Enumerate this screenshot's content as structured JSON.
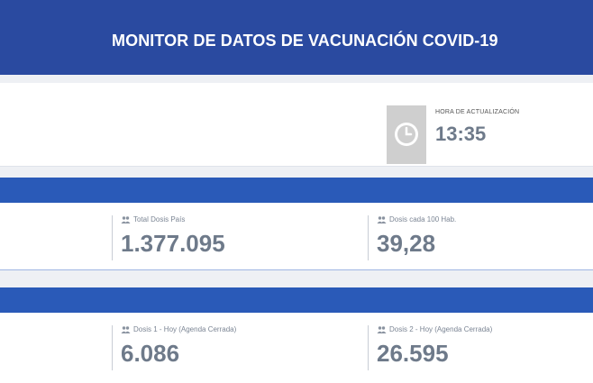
{
  "header": {
    "title": "MONITOR DE DATOS DE VACUNACIÓN COVID-19"
  },
  "update": {
    "label": "HORA DE ACTUALIZACIÓN",
    "time": "13:35",
    "icon": "clock-icon"
  },
  "stats_row1": [
    {
      "label": "Total Dosis País",
      "value": "1.377.095",
      "icon": "users-icon"
    },
    {
      "label": "Dosis cada 100 Hab.",
      "value": "39,28",
      "icon": "users-icon"
    }
  ],
  "stats_row2": [
    {
      "label": "Dosis 1 - Hoy (Agenda Cerrada)",
      "value": "6.086",
      "icon": "users-icon"
    },
    {
      "label": "Dosis 2 - Hoy (Agenda Cerrada)",
      "value": "26.595",
      "icon": "users-icon"
    }
  ],
  "colors": {
    "header": "#2a4aa0",
    "band": "#2a5ab8",
    "value_text": "#6e7a8a"
  }
}
